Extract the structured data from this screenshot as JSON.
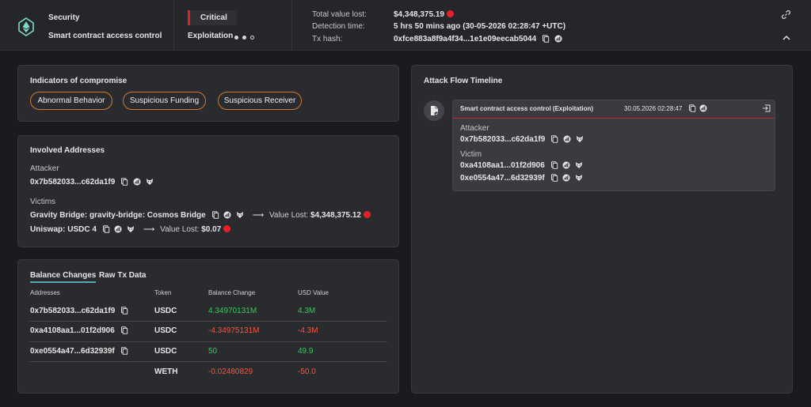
{
  "header": {
    "category": "Security",
    "attack_type": "Smart contract access control",
    "severity": "Critical",
    "stage": "Exploitation",
    "total_value_lost_label": "Total value lost:",
    "total_value_lost": "$4,348,375.19",
    "detection_time_label": "Detection time:",
    "detection_time": "5 hrs 50 mins ago (30-05-2026 02:28:47 +UTC)",
    "tx_hash_label": "Tx hash:",
    "tx_hash": "0xfce883a8f9a4f34...1e1e09eecab5044"
  },
  "indicators": {
    "title": "Indicators of compromise",
    "items": [
      "Abnormal Behavior",
      "Suspicious Funding",
      "Suspicious Receiver"
    ]
  },
  "involved": {
    "title": "Involved Addresses",
    "attacker_label": "Attacker",
    "attacker": "0x7b582033...c62da1f9",
    "victims_label": "Victims",
    "victims": [
      {
        "name": "Gravity Bridge: gravity-bridge: Cosmos Bridge",
        "value_label": "Value Lost:",
        "value": "$4,348,375.12"
      },
      {
        "name": "Uniswap: USDC 4",
        "value_label": "Value Lost:",
        "value": "$0.07"
      }
    ]
  },
  "balance": {
    "tabs": [
      "Balance Changes",
      "Raw Tx Data"
    ],
    "columns": [
      "Addresses",
      "Token",
      "Balance Change",
      "USD Value"
    ],
    "rows": [
      {
        "address": "0x7b582033...c62da1f9",
        "token": "USDC",
        "change": "4.34970131M",
        "usd": "4.3M",
        "sign": "pos"
      },
      {
        "address": "0xa4108aa1...01f2d906",
        "token": "USDC",
        "change": "-4.34975131M",
        "usd": "-4.3M",
        "sign": "neg"
      },
      {
        "address": "0xe0554a47...6d32939f",
        "token": "USDC",
        "change": "50",
        "usd": "49.9",
        "sign": "pos"
      },
      {
        "address": "",
        "token": "WETH",
        "change": "-0.02480829",
        "usd": "-50.0",
        "sign": "neg"
      }
    ]
  },
  "timeline": {
    "title": "Attack Flow Timeline",
    "event_title": "Smart contract access control  (Exploitation)",
    "event_time": "30.05.2026 02:28:47",
    "attacker_label": "Attacker",
    "attacker": "0x7b582033...c62da1f9",
    "victim_label": "Victim",
    "victims": [
      "0xa4108aa1...01f2d906",
      "0xe0554a47...6d32939f"
    ]
  },
  "colors": {
    "critical": "#e0232b",
    "pill_border": "#d27a2c",
    "positive": "#38c95b",
    "negative": "#f2573f",
    "tab_underline": "#5aa7b2"
  },
  "icons": [
    "ethereum-logo",
    "copy-icon",
    "explorer-icon",
    "fox-icon",
    "link-icon",
    "chevron-up-icon",
    "arrow-right-icon",
    "exit-icon",
    "document-icon"
  ]
}
